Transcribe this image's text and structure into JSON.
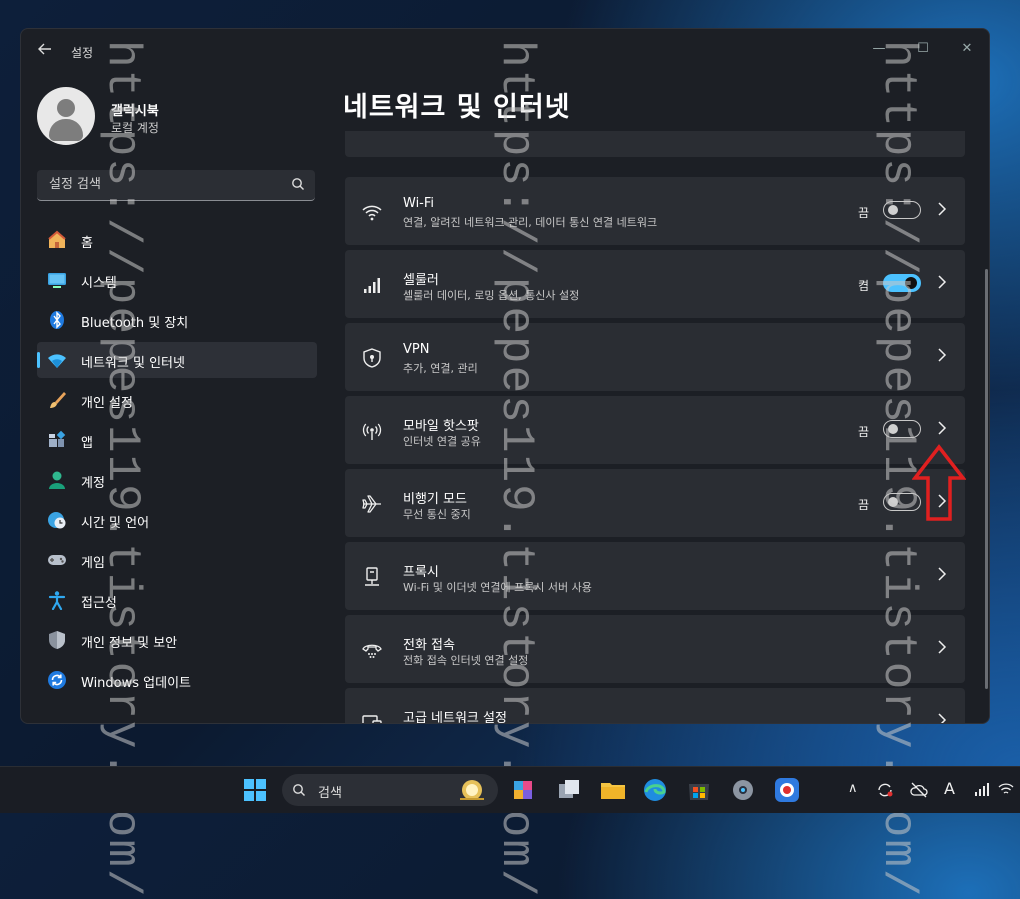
{
  "window": {
    "title": "설정",
    "controls": {
      "minimize": "—",
      "maximize": "☐",
      "close": "✕"
    }
  },
  "profile": {
    "name": "갤럭시북",
    "account_type": "로컬 계정"
  },
  "search": {
    "placeholder": "설정 검색"
  },
  "sidebar": {
    "items": [
      {
        "label": "홈",
        "icon": "home-icon"
      },
      {
        "label": "시스템",
        "icon": "system-icon"
      },
      {
        "label": "Bluetooth 및 장치",
        "icon": "bluetooth-icon"
      },
      {
        "label": "네트워크 및 인터넷",
        "icon": "network-icon",
        "active": true
      },
      {
        "label": "개인 설정",
        "icon": "brush-icon"
      },
      {
        "label": "앱",
        "icon": "apps-icon"
      },
      {
        "label": "계정",
        "icon": "account-icon"
      },
      {
        "label": "시간 및 언어",
        "icon": "globe-clock-icon"
      },
      {
        "label": "게임",
        "icon": "gamepad-icon"
      },
      {
        "label": "접근성",
        "icon": "accessibility-icon"
      },
      {
        "label": "개인 정보 및 보안",
        "icon": "shield-icon"
      },
      {
        "label": "Windows 업데이트",
        "icon": "update-icon"
      }
    ]
  },
  "main": {
    "title": "네트워크 및 인터넷",
    "cards": [
      {
        "title": "Wi-Fi",
        "subtitle": "연결, 알려진 네트워크 관리, 데이터 통신 연결 네트워크",
        "state": "끔",
        "toggle": "off"
      },
      {
        "title": "셀룰러",
        "subtitle": "셀룰러 데이터, 로밍 옵션, 통신사 설정",
        "state": "켬",
        "toggle": "on"
      },
      {
        "title": "VPN",
        "subtitle": "추가, 연결, 관리"
      },
      {
        "title": "모바일 핫스팟",
        "subtitle": "인터넷 연결 공유",
        "state": "끔",
        "toggle": "off"
      },
      {
        "title": "비행기 모드",
        "subtitle": "무선 통신 중지",
        "state": "끔",
        "toggle": "off"
      },
      {
        "title": "프록시",
        "subtitle": "Wi-Fi 및 이더넷 연결에 프록시 서버 사용"
      },
      {
        "title": "전화 접속",
        "subtitle": "전화 접속 인터넷 연결 설정"
      },
      {
        "title": "고급 네트워크 설정",
        "subtitle": ""
      }
    ]
  },
  "watermark": "https://pepes119.tistory.com/",
  "taskbar": {
    "search_label": "검색",
    "tray_lang": "A"
  },
  "colors": {
    "accent": "#4cc2ff",
    "annotation": "#e02020"
  }
}
